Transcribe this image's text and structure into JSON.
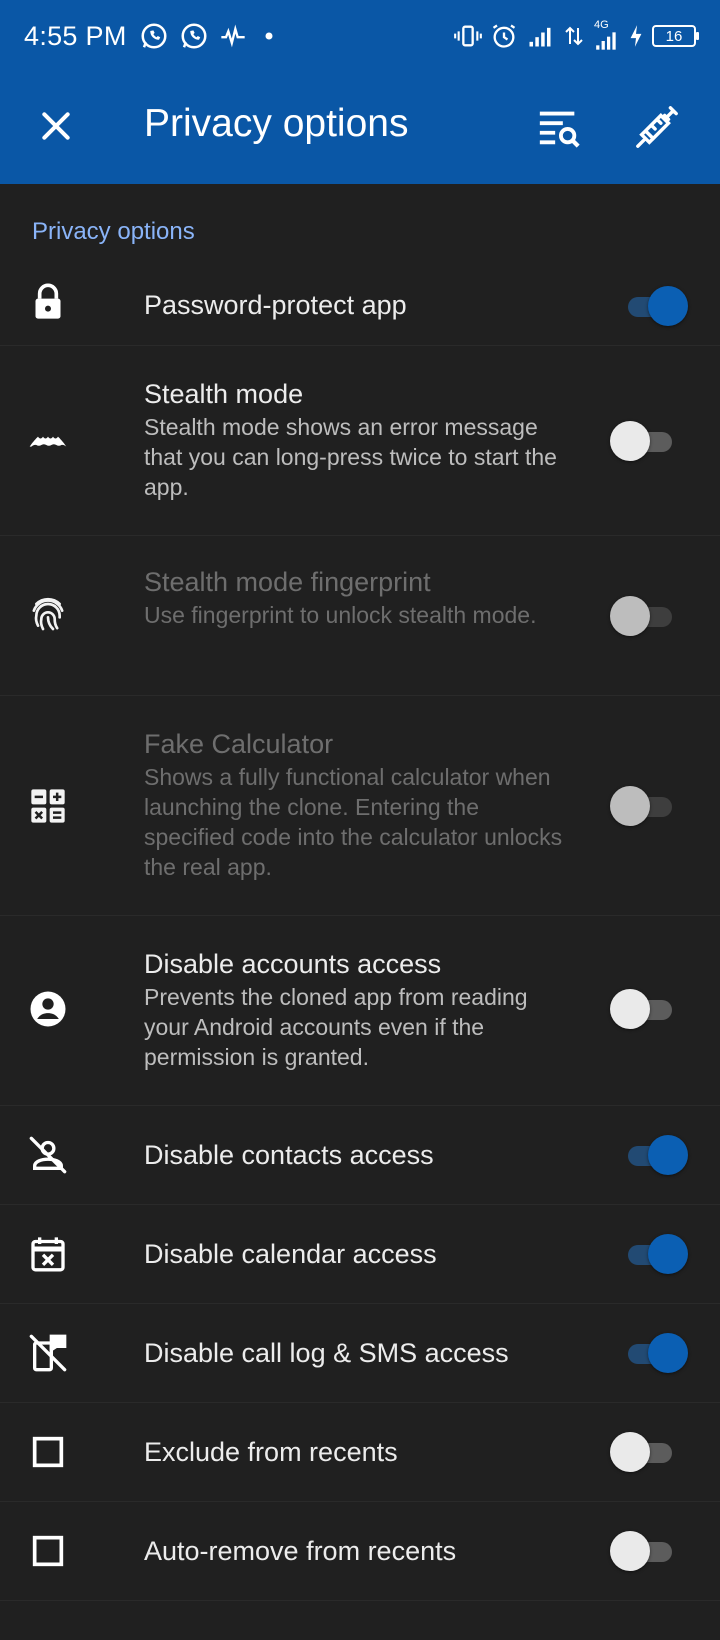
{
  "status_bar": {
    "time": "4:55 PM",
    "battery": "16",
    "network": "4G",
    "icons": [
      "whatsapp-icon",
      "whatsapp-icon",
      "activity-icon",
      "dot-icon",
      "vibrate-icon",
      "alarm-icon",
      "signal-icon",
      "data-arrows-icon",
      "signal-4g-icon",
      "charging-icon",
      "battery-icon"
    ]
  },
  "app_bar": {
    "title": "Privacy options",
    "close_icon": "close-icon",
    "filter_icon": "search-filter-icon",
    "fix_icon": "syringe-icon"
  },
  "section": {
    "header": "Privacy options"
  },
  "settings": [
    {
      "icon": "lock-icon",
      "title": "Password-protect app",
      "summary": "",
      "toggle": "on",
      "enabled": true
    },
    {
      "icon": "stealth-icon",
      "title": "Stealth mode",
      "summary": "Stealth mode shows an error message that you can long-press twice to start the app.",
      "toggle": "off",
      "enabled": true
    },
    {
      "icon": "fingerprint-icon",
      "title": "Stealth mode fingerprint",
      "summary": "Use fingerprint to unlock stealth mode.",
      "toggle": "off",
      "enabled": false
    },
    {
      "icon": "calculator-icon",
      "title": "Fake Calculator",
      "summary": "Shows a fully functional calculator when launching the clone. Entering the specified code into the calculator unlocks the real app.",
      "toggle": "off",
      "enabled": false
    },
    {
      "icon": "account-circle-icon",
      "title": "Disable accounts access",
      "summary": "Prevents the cloned app from reading your Android accounts even if the permission is granted.",
      "toggle": "off",
      "enabled": true
    },
    {
      "icon": "contacts-off-icon",
      "title": "Disable contacts access",
      "summary": "",
      "toggle": "on",
      "enabled": true
    },
    {
      "icon": "calendar-off-icon",
      "title": "Disable calendar access",
      "summary": "",
      "toggle": "on",
      "enabled": true
    },
    {
      "icon": "phone-sms-off-icon",
      "title": "Disable call log & SMS access",
      "summary": "",
      "toggle": "on",
      "enabled": true
    },
    {
      "icon": "square-icon",
      "title": "Exclude from recents",
      "summary": "",
      "toggle": "off",
      "enabled": true
    },
    {
      "icon": "square-icon",
      "title": "Auto-remove from recents",
      "summary": "",
      "toggle": "off",
      "enabled": true
    }
  ],
  "colors": {
    "app_bar": "#0a57a6",
    "background": "#202020",
    "accent": "#8ab4f8",
    "toggle_on": "#0b5fb3"
  }
}
